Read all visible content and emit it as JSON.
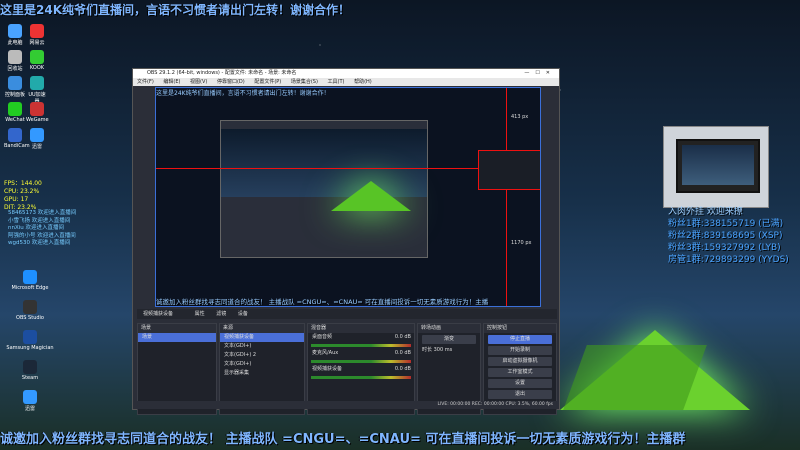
{
  "ticker_top": "这里是24K纯爷们直播间，言语不习惯者请出门左转！谢谢合作！",
  "ticker_bottom": "诚邀加入粉丝群找寻志同道合的战友！ 主播战队 =CNGU=、=CNAU= 可在直播间投诉一切无素质游戏行为！主播群",
  "desktop_icons": [
    {
      "label": "此电脑",
      "color": "#4aa3ff"
    },
    {
      "label": "网易云",
      "color": "#e33"
    },
    {
      "label": "回收站",
      "color": "#bbb"
    },
    {
      "label": "KOOK",
      "color": "#3c3"
    },
    {
      "label": "控制面板",
      "color": "#3a8dde"
    },
    {
      "label": "UU加速器",
      "color": "#2aa"
    },
    {
      "label": "WeChat",
      "color": "#2c2"
    },
    {
      "label": "WeGame",
      "color": "#c33"
    },
    {
      "label": "BandiCam",
      "color": "#36c"
    },
    {
      "label": "迅雷",
      "color": "#39f"
    }
  ],
  "desktop_icons_lower": [
    {
      "label": "Microsoft Edge",
      "color": "#1e90ff"
    },
    {
      "label": "OBS Studio",
      "color": "#333"
    },
    {
      "label": "Samsung Magician",
      "color": "#1c4ea0"
    },
    {
      "label": "Steam",
      "color": "#1b2838"
    },
    {
      "label": "迅雷",
      "color": "#39f"
    }
  ],
  "stats": [
    "FPS：144.00",
    "CPU: 23.2%",
    "GPU: 17",
    "DIT: 23.2%"
  ],
  "chat_lines": [
    "58465173 欢迎进入直播间",
    "小雪飞扬 欢迎进入直播间",
    "nnXiu 欢迎进入直播间",
    "阿强的小号 欢迎进入直播间",
    "wgd530 欢迎进入直播间"
  ],
  "obs": {
    "title": "OBS 29.1.2 (64-bit, windows) - 配置文件: 未命名 - 场景: 未命名",
    "menu": [
      "文件(F)",
      "编辑(E)",
      "视图(V)",
      "停靠窗口(D)",
      "配置文件(P)",
      "场景集合(S)",
      "工具(T)",
      "帮助(H)"
    ],
    "preview_ticker": "这里是24K纯爷们直播间，言语不习惯者请出门左转！谢谢合作！",
    "preview_bottom": "诚邀加入粉丝群找寻志同道合的战友！ 主播战队 =CNGU=、=CNAU= 可在直播间投诉一切无素质游戏行为！主播",
    "guide_top": "413 px",
    "guide_bottom": "1170 px",
    "source_label": "视频捕获设备",
    "props_btn": "属性",
    "filter_btn": "滤镜",
    "device_label": "设备",
    "panels": {
      "scenes": {
        "title": "场景",
        "items": [
          "场景"
        ]
      },
      "sources": {
        "title": "来源",
        "items": [
          "视频捕获设备",
          "文本(GDI+)",
          "文本(GDI+) 2",
          "文本(GDI+)",
          "显示器采集"
        ]
      },
      "mixer": {
        "title": "混音器",
        "items": [
          {
            "name": "桌面音频",
            "db": "0.0 dB"
          },
          {
            "name": "麦克风/Aux",
            "db": "0.0 dB"
          },
          {
            "name": "视频捕获设备",
            "db": "0.0 dB"
          }
        ]
      },
      "transitions": {
        "title": "转场动画",
        "type": "渐变",
        "duration_label": "时长",
        "duration": "300 ms"
      },
      "controls": {
        "title": "控制按钮",
        "buttons": [
          "停止直播",
          "开始录制",
          "启动虚拟摄像机",
          "工作室模式",
          "设置",
          "退出"
        ]
      }
    },
    "status": "LIVE: 00:00:00   REC: 00:00:00   CPU: 3.5%, 60.00 fps"
  },
  "overlay_title": "入肉外挂 欢迎来撩",
  "fan_groups": [
    "粉丝1群:338155719 (已满)",
    "粉丝2群:839168695 (XSP)",
    "粉丝3群:159327992 (LYB)",
    "房管1群:729893299 (YYDS)"
  ]
}
